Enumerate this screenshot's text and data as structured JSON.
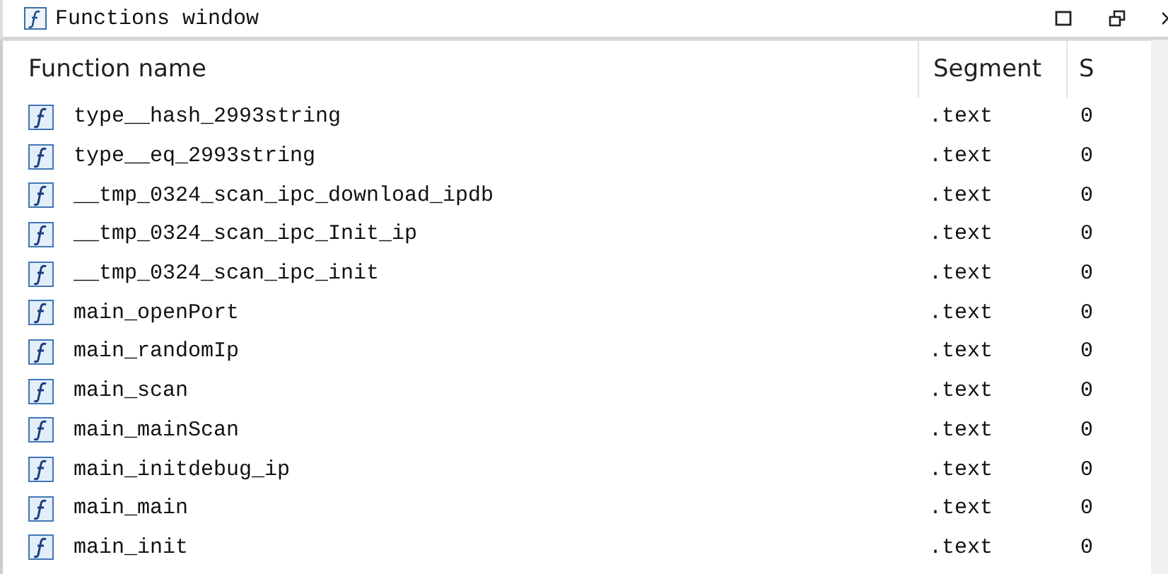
{
  "window": {
    "title": "Functions window"
  },
  "table": {
    "columns": [
      "Function name",
      "Segment",
      "S"
    ],
    "rows": [
      {
        "name": "type__hash_2993string",
        "segment": ".text",
        "column_3": "0"
      },
      {
        "name": "type__eq_2993string",
        "segment": ".text",
        "column_3": "0"
      },
      {
        "name": "__tmp_0324_scan_ipc_download_ipdb",
        "segment": ".text",
        "column_3": "0"
      },
      {
        "name": "__tmp_0324_scan_ipc_Init_ip",
        "segment": ".text",
        "column_3": "0"
      },
      {
        "name": "__tmp_0324_scan_ipc_init",
        "segment": ".text",
        "column_3": "0"
      },
      {
        "name": "main_openPort",
        "segment": ".text",
        "column_3": "0"
      },
      {
        "name": "main_randomIp",
        "segment": ".text",
        "column_3": "0"
      },
      {
        "name": "main_scan",
        "segment": ".text",
        "column_3": "0"
      },
      {
        "name": "main_mainScan",
        "segment": ".text",
        "column_3": "0"
      },
      {
        "name": "main_initdebug_ip",
        "segment": ".text",
        "column_3": "0"
      },
      {
        "name": "main_main",
        "segment": ".text",
        "column_3": "0"
      },
      {
        "name": "main_init",
        "segment": ".text",
        "column_3": "0"
      }
    ]
  }
}
